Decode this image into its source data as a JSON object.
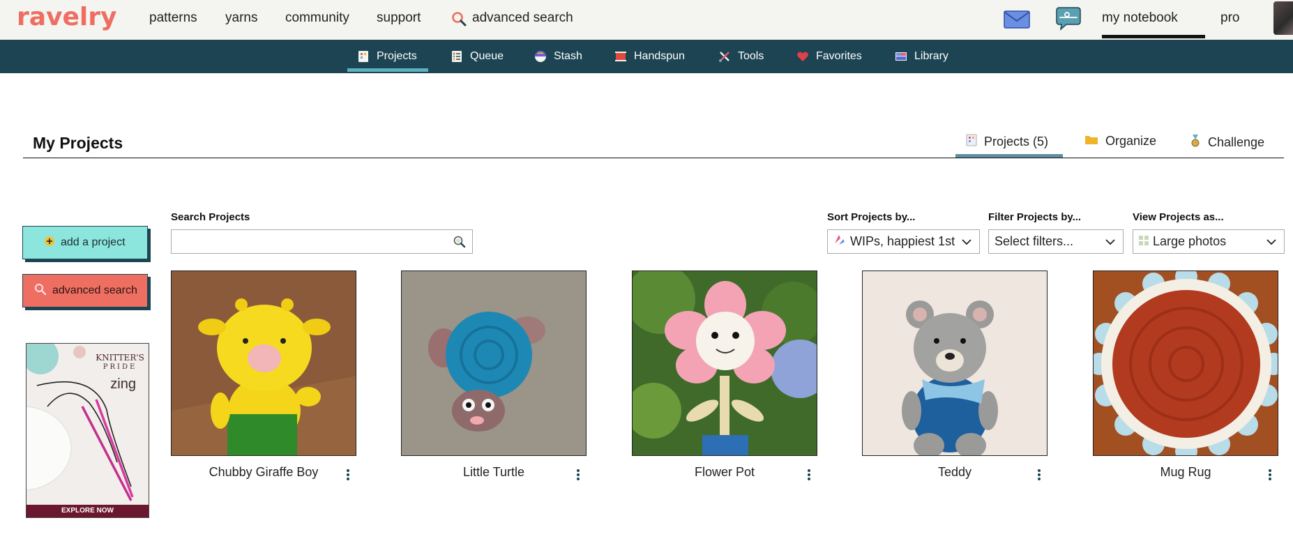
{
  "header": {
    "logo": "ravelry",
    "nav": [
      "patterns",
      "yarns",
      "community",
      "support"
    ],
    "advanced_search": "advanced search",
    "my_notebook": "my notebook",
    "pro": "pro"
  },
  "subnav": {
    "items": [
      "Projects",
      "Queue",
      "Stash",
      "Handspun",
      "Tools",
      "Favorites",
      "Library"
    ],
    "active": "Projects"
  },
  "page": {
    "title": "My Projects",
    "tabs": [
      "Projects (5)",
      "Organize",
      "Challenge"
    ],
    "active_tab": "Projects (5)"
  },
  "sidebar": {
    "add_project": "add a project",
    "advanced_search": "advanced search",
    "ad": {
      "brand_line1": "KNITTER'S",
      "brand_line2": "PRIDE",
      "product": "zing",
      "cta": "EXPLORE NOW"
    }
  },
  "controls": {
    "search_label": "Search Projects",
    "search_value": "",
    "sort_label": "Sort Projects by...",
    "sort_value": "WIPs, happiest 1st",
    "filter_label": "Filter Projects by...",
    "filter_value": "Select filters...",
    "view_label": "View Projects as...",
    "view_value": "Large photos"
  },
  "projects": [
    {
      "title": "Chubby Giraffe Boy",
      "image": "yellow-giraffe-amigurumi"
    },
    {
      "title": "Little Turtle",
      "image": "blue-turtle-amigurumi"
    },
    {
      "title": "Flower Pot",
      "image": "pink-flower-amigurumi"
    },
    {
      "title": "Teddy",
      "image": "grey-teddy-amigurumi"
    },
    {
      "title": "Mug Rug",
      "image": "red-round-mug-rug"
    }
  ],
  "colors": {
    "brand": "#ee6e62",
    "subnav_bg": "#1c4452",
    "add_button": "#8de6dd",
    "active_underline": "#5db1c2"
  }
}
